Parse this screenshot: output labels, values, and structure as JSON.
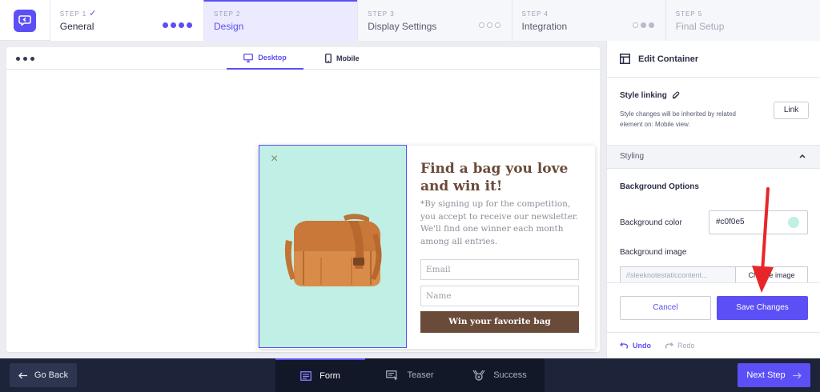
{
  "steps": [
    {
      "num": "STEP 1",
      "title": "General",
      "check": "✓"
    },
    {
      "num": "STEP 2",
      "title": "Design"
    },
    {
      "num": "STEP 3",
      "title": "Display Settings"
    },
    {
      "num": "STEP 4",
      "title": "Integration"
    },
    {
      "num": "STEP 5",
      "title": "Final Setup"
    }
  ],
  "canvas": {
    "tabs": {
      "desktop": "Desktop",
      "mobile": "Mobile"
    }
  },
  "popup": {
    "close": "×",
    "title": "Find a bag you love and win it!",
    "description": "*By signing up for the competition, you accept to receive our newsletter. We'll find one winner each month among all entries.",
    "email_placeholder": "Email",
    "name_placeholder": "Name",
    "button": "Win your favorite bag",
    "bg_color": "#c0f0e5",
    "button_color": "#6a4b3a"
  },
  "panel": {
    "title": "Edit Container",
    "style_linking": "Style linking",
    "style_linking_desc": "Style changes will be inherited by related element on: Mobile view.",
    "link_button": "Link",
    "styling": "Styling",
    "background_options": "Background Options",
    "background_color_label": "Background color",
    "background_color_value": "#c0f0e5",
    "background_image_label": "Background image",
    "background_image_value": "//sleeknotestaticcontent...",
    "choose_image": "Choose image",
    "cancel": "Cancel",
    "save": "Save Changes",
    "undo": "Undo",
    "redo": "Redo"
  },
  "bottom": {
    "go_back": "Go Back",
    "tabs": [
      "Form",
      "Teaser",
      "Success"
    ],
    "next": "Next Step"
  },
  "colors": {
    "accent": "#5b4ff5",
    "dark_bar": "#1d2338"
  }
}
